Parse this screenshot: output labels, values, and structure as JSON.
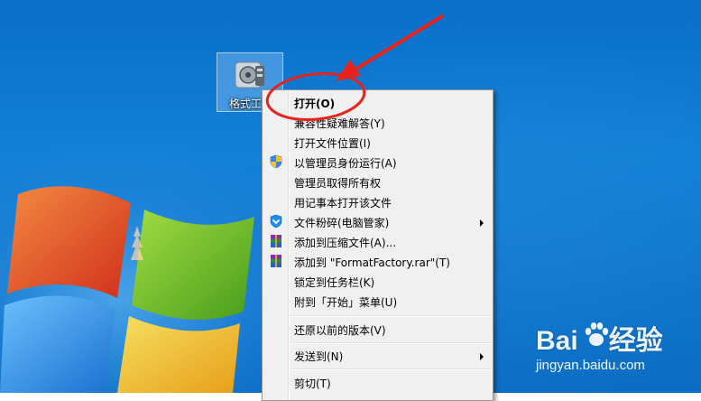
{
  "desktop_icon": {
    "label": "格式工厂",
    "icon": "format-factory-icon"
  },
  "context_menu": {
    "items": [
      {
        "label": "打开(O)",
        "bold": true,
        "icon": null,
        "submenu": false
      },
      {
        "label": "兼容性疑难解答(Y)",
        "icon": null,
        "submenu": false
      },
      {
        "label": "打开文件位置(I)",
        "icon": null,
        "submenu": false
      },
      {
        "label": "以管理员身份运行(A)",
        "icon": "uac-shield-icon",
        "submenu": false
      },
      {
        "label": "管理员取得所有权",
        "icon": null,
        "submenu": false
      },
      {
        "label": "用记事本打开该文件",
        "icon": null,
        "submenu": false
      },
      {
        "label": "文件粉碎(电脑管家)",
        "icon": "tencent-shield-icon",
        "submenu": true
      },
      {
        "label": "添加到压缩文件(A)...",
        "icon": "winrar-icon",
        "submenu": false
      },
      {
        "label": "添加到 \"FormatFactory.rar\"(T)",
        "icon": "winrar-icon",
        "submenu": false
      },
      {
        "label": "锁定到任务栏(K)",
        "icon": null,
        "submenu": false
      },
      {
        "label": "附到「开始」菜单(U)",
        "icon": null,
        "submenu": false
      },
      {
        "label": "还原以前的版本(V)",
        "icon": null,
        "submenu": false
      },
      {
        "label": "发送到(N)",
        "icon": null,
        "submenu": true
      },
      {
        "label": "剪切(T)",
        "icon": null,
        "submenu": false
      }
    ]
  },
  "watermark": {
    "brand_left": "Bai",
    "brand_right": "经验",
    "url": "jingyan.baidu.com"
  },
  "colors": {
    "annotation_red": "#e8231c",
    "desktop_blue": "#0f78d2",
    "menu_bg": "#f0f0f0"
  }
}
